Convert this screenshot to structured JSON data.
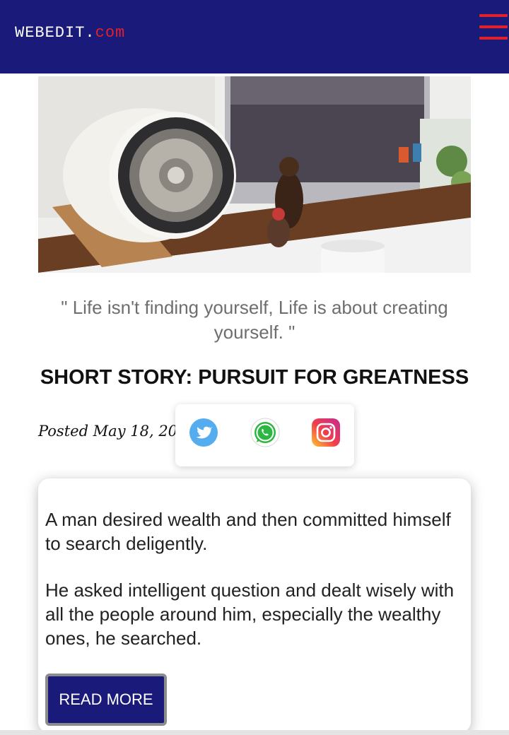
{
  "header": {
    "brand_name": "WEBEDIT.",
    "brand_tld": "com",
    "bg_color": "#1a1a7a",
    "accent_color": "#e0202a",
    "menu_icon": "hamburger-menu-icon"
  },
  "hero": {
    "image_name": "desk-speaker-photo"
  },
  "quote": "\" Life isn't finding yourself, Life is about creating yourself. \"",
  "post": {
    "title": "SHORT STORY: PURSUIT FOR GREATNESS",
    "posted": "Posted May 18, 2021"
  },
  "share": {
    "icons": [
      "twitter-icon",
      "whatsapp-icon",
      "instagram-icon"
    ]
  },
  "excerpt": {
    "paragraph_1": "A man desired wealth and then committed himself to search deligently.",
    "paragraph_2": "He asked intelligent question and dealt wisely with all the people around him, especially the wealthy ones, he searched.",
    "read_more_label": "READ MORE"
  }
}
